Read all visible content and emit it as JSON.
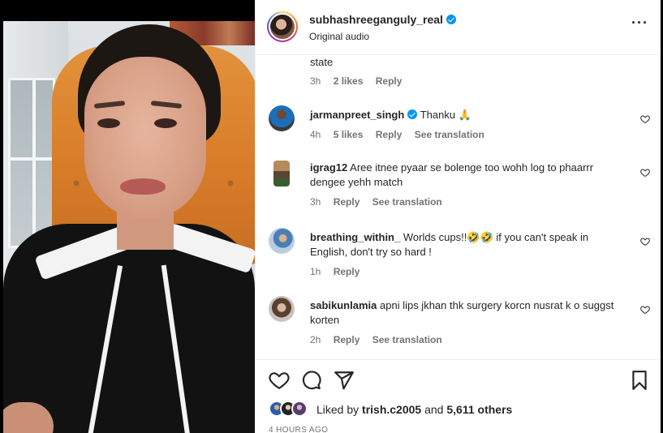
{
  "post": {
    "username": "subhashreeganguly_real",
    "audio": "Original audio",
    "more_icon": "more-horizontal-icon"
  },
  "comments": [
    {
      "username": "",
      "text": "state",
      "time": "3h",
      "likes": "2 likes",
      "reply": "Reply",
      "translation": ""
    },
    {
      "username": "jarmanpreet_singh",
      "verified": true,
      "text": "Thanku 🙏",
      "time": "4h",
      "likes": "5 likes",
      "reply": "Reply",
      "translation": "See translation"
    },
    {
      "username": "igrag12",
      "text": "Aree itnee pyaar se bolenge too wohh log to phaarrr dengee yehh match",
      "time": "3h",
      "likes": "",
      "reply": "Reply",
      "translation": "See translation"
    },
    {
      "username": "breathing_within_",
      "text": "Worlds cups!!🤣🤣 if you can't speak in English, don't try so hard !",
      "time": "1h",
      "likes": "",
      "reply": "Reply",
      "translation": ""
    },
    {
      "username": "sabikunlamia",
      "text": "apni lips jkhan thk surgery korcn nusrat k o suggst korten",
      "time": "2h",
      "likes": "",
      "reply": "Reply",
      "translation": "See translation"
    }
  ],
  "actions": {
    "like_icon": "heart-icon",
    "comment_icon": "comment-icon",
    "share_icon": "share-icon",
    "save_icon": "bookmark-icon"
  },
  "likes": {
    "prefix": "Liked by",
    "user": "trish.c2005",
    "connector": "and",
    "others": "5,611 others"
  },
  "timestamp": "4 HOURS AGO",
  "colors": {
    "verified": "#0095f6",
    "secondary_text": "#737373",
    "primary_text": "#262626"
  }
}
